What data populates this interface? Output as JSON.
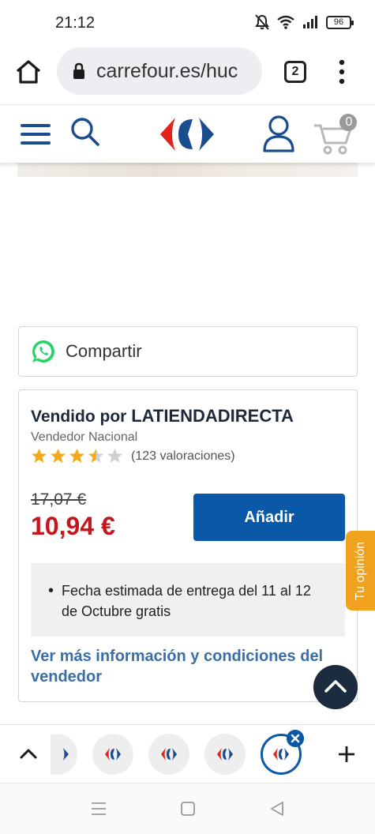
{
  "status_bar": {
    "time": "21:12",
    "battery": "96",
    "icons": [
      "bell-muted-icon",
      "wifi-icon",
      "signal-icon",
      "battery-icon"
    ]
  },
  "browser": {
    "url": "carrefour.es/huc",
    "tab_count": "2",
    "icons": [
      "home-icon",
      "lock-icon",
      "menu-dots-icon"
    ]
  },
  "site_header": {
    "cart_count": "0",
    "icons": [
      "hamburger-icon",
      "search-icon",
      "carrefour-logo",
      "user-icon",
      "cart-icon"
    ],
    "accent": "#1a4d8f"
  },
  "share": {
    "label": "Compartir",
    "icon": "whatsapp-icon"
  },
  "seller": {
    "sold_by_prefix": "Vendido por",
    "seller_name": "LATIENDADIRECTA",
    "seller_type": "Vendedor Nacional",
    "rating": 3.5,
    "rating_max": 5,
    "rating_count": "(123 valoraciones)",
    "old_price": "17,07 €",
    "price": "10,94 €",
    "add_button": "Añadir",
    "delivery_items": [
      "Fecha estimada de entrega del 11 al 12 de Octubre gratis"
    ],
    "more_info_link": "Ver más información y condiciones del vendedor",
    "price_color": "#c4161c",
    "button_color": "#0a58a8"
  },
  "floating": {
    "opinion_label": "Tu opinión",
    "opinion_color": "#f0a21e"
  },
  "tab_strip": {
    "tabs": [
      "tab-1",
      "tab-2",
      "tab-3",
      "tab-4",
      "tab-5-active"
    ]
  },
  "nav_bar": {
    "buttons": [
      "recents-button",
      "home-button",
      "back-button"
    ]
  }
}
